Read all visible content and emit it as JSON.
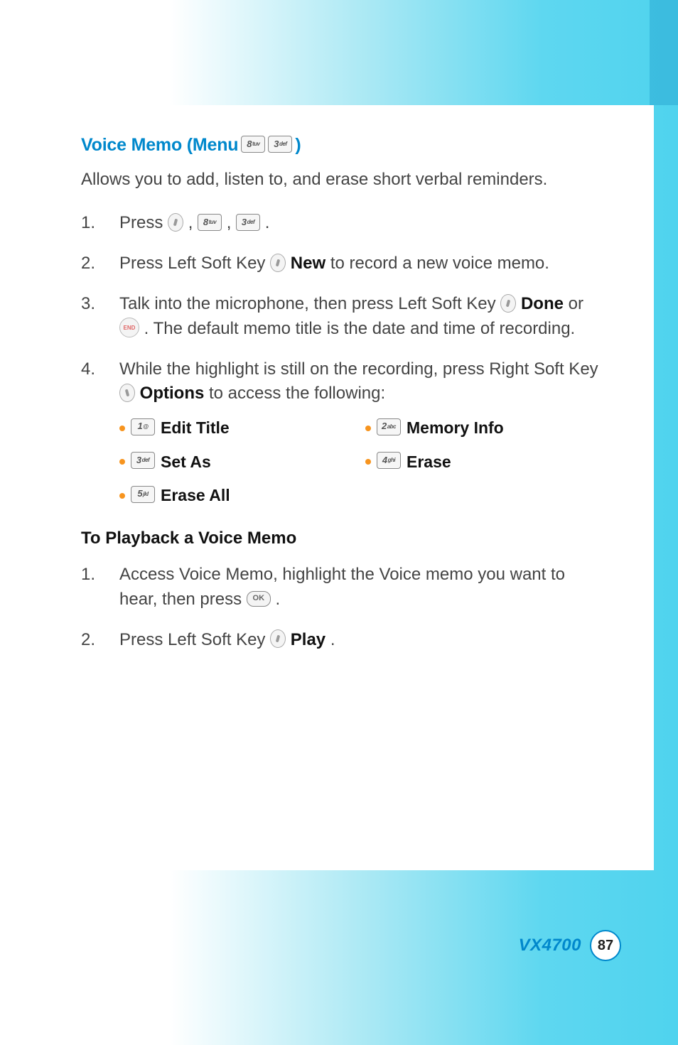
{
  "heading": {
    "prefix": "Voice Memo (Menu ",
    "key1_digit": "8",
    "key1_sub": "tuv",
    "key2_digit": "3",
    "key2_sub": "def",
    "suffix": ")"
  },
  "intro": "Allows you to add, listen to, and erase short verbal reminders.",
  "steps": {
    "s1": {
      "t1": "Press ",
      "k1_digit": "8",
      "k1_sub": "tuv",
      "k2_digit": "3",
      "k2_sub": "def",
      "comma": " , ",
      "period": " ."
    },
    "s2": {
      "t1": "Press Left Soft Key ",
      "b1": "New",
      "t2": " to record a new voice memo."
    },
    "s3": {
      "t1": "Talk into the microphone, then press Left Soft Key ",
      "b1": "Done",
      "t2": " or ",
      "endLabel": "END",
      "t3": " . The default memo title is the date and time of recording."
    },
    "s4": {
      "t1": "While the highlight is still on the recording, press Right Soft Key ",
      "b1": "Options",
      "t2": " to access the following:"
    }
  },
  "options": [
    {
      "key_digit": "1",
      "key_sub": "@",
      "label": "Edit Title"
    },
    {
      "key_digit": "2",
      "key_sub": "abc",
      "label": "Memory Info"
    },
    {
      "key_digit": "3",
      "key_sub": "def",
      "label": "Set As"
    },
    {
      "key_digit": "4",
      "key_sub": "ghi",
      "label": "Erase"
    },
    {
      "key_digit": "5",
      "key_sub": "jkl",
      "label": "Erase All"
    }
  ],
  "subhead": "To Playback a Voice Memo",
  "playback": {
    "p1": {
      "t1": "Access Voice Memo, highlight the Voice memo you want to hear, then press ",
      "okLabel": "OK",
      "t2": " ."
    },
    "p2": {
      "t1": "Press Left Soft Key ",
      "b1": "Play",
      "t2": "."
    }
  },
  "footer": {
    "model": "VX4700",
    "page": "87"
  }
}
